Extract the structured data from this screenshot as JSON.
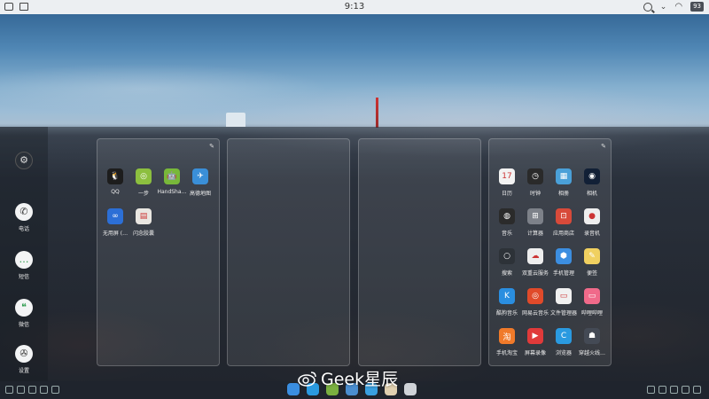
{
  "statusbar": {
    "time": "9:13",
    "battery": "93"
  },
  "left_dock": {
    "items": [
      {
        "label": "",
        "icon": "gear-icon"
      },
      {
        "label": "电话",
        "icon": "phone-icon"
      },
      {
        "label": "短信",
        "icon": "message-icon"
      },
      {
        "label": "微信",
        "icon": "wechat-icon"
      },
      {
        "label": "设置",
        "icon": "mercedes-settings-icon"
      }
    ]
  },
  "panel1": {
    "apps": [
      {
        "label": "QQ",
        "color": "#1d1d1d",
        "glyph": "🐧"
      },
      {
        "label": "一步",
        "color": "#8cbf3f",
        "glyph": "◎"
      },
      {
        "label": "HandSha…",
        "color": "#78b83a",
        "glyph": "🤖"
      },
      {
        "label": "高德地图",
        "color": "#3a8fd8",
        "glyph": "✈"
      },
      {
        "label": "无用屏 (…",
        "color": "#2c6fd6",
        "glyph": "∞"
      },
      {
        "label": "闪念胶囊",
        "color": "#e9e6e1",
        "glyph": "▤"
      }
    ]
  },
  "panel4": {
    "apps": [
      {
        "label": "日历",
        "color": "#f2f2f2",
        "glyph": "17"
      },
      {
        "label": "时钟",
        "color": "#2a2a2a",
        "glyph": "◷"
      },
      {
        "label": "相册",
        "color": "#4aa0d8",
        "glyph": "▦"
      },
      {
        "label": "相机",
        "color": "#122036",
        "glyph": "◉"
      },
      {
        "label": "音乐",
        "color": "#2b2b2b",
        "glyph": "◍"
      },
      {
        "label": "计算器",
        "color": "#7d8189",
        "glyph": "⊞"
      },
      {
        "label": "应用商店",
        "color": "#d84a3a",
        "glyph": "⊡"
      },
      {
        "label": "录音机",
        "color": "#eeeeee",
        "glyph": "●"
      },
      {
        "label": "搜索",
        "color": "#2d3238",
        "glyph": "○"
      },
      {
        "label": "双重云服务",
        "color": "#eeeeee",
        "glyph": "☁"
      },
      {
        "label": "手机管理",
        "color": "#3c8ee0",
        "glyph": "⬢"
      },
      {
        "label": "便签",
        "color": "#f0d060",
        "glyph": "✎"
      },
      {
        "label": "酷狗音乐",
        "color": "#2a8ee0",
        "glyph": "K"
      },
      {
        "label": "网易云音乐",
        "color": "#e04a2a",
        "glyph": "◎"
      },
      {
        "label": "文件管理器",
        "color": "#f0f0f0",
        "glyph": "▭"
      },
      {
        "label": "哔哩哔哩",
        "color": "#f06a8a",
        "glyph": "▭"
      },
      {
        "label": "手机淘宝",
        "color": "#f07a2a",
        "glyph": "淘"
      },
      {
        "label": "屏幕录像",
        "color": "#e03a3a",
        "glyph": "▶"
      },
      {
        "label": "浏览器",
        "color": "#2a9ae0",
        "glyph": "C"
      },
      {
        "label": "穿越火线…",
        "color": "#444a55",
        "glyph": "☗"
      }
    ]
  },
  "watermark": {
    "text": "Geek星辰"
  },
  "colors": {
    "statusbar_bg": "#eceff2",
    "panel_border": "rgba(255,255,255,0.22)"
  }
}
